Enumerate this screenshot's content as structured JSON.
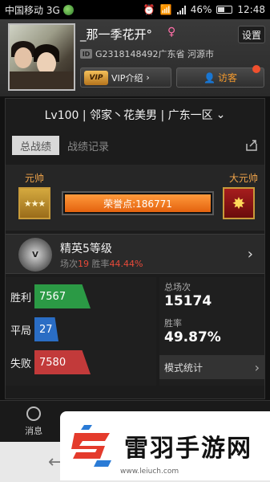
{
  "status_bar": {
    "carrier": "中国移动 3G",
    "network": "3G",
    "battery": "46%",
    "time": "12:48"
  },
  "profile": {
    "nickname": "_那一季花开°",
    "gender_symbol": "♀",
    "id_badge": "ID",
    "id_location": "G2318148492广东省 河源市",
    "settings_label": "设置",
    "vip_logo": "VIP",
    "vip_label": "VIP介绍",
    "visitor_label": "访客"
  },
  "card": {
    "level_title": "Lv100 | 邻家丶花美男 | 广东一区",
    "tabs": [
      {
        "label": "总战绩",
        "active": true
      },
      {
        "label": "战绩记录",
        "active": false
      }
    ],
    "rank": {
      "left_label": "元帅",
      "right_label": "大元帅",
      "left_stars": "★★★",
      "right_star": "✸",
      "honor_text": "荣誉点:186771",
      "honor_progress": 1.0
    },
    "elite": {
      "badge": "V",
      "title": "精英5等级",
      "sub_prefix": "场次",
      "matches": "19",
      "sub_mid": " 胜率",
      "win_rate": "44.44%"
    },
    "stats": {
      "win_label": "胜利",
      "win_value": "7567",
      "draw_label": "平局",
      "draw_value": "27",
      "lose_label": "失败",
      "lose_value": "7580",
      "total_label": "总场次",
      "total_value": "15174",
      "rate_label": "胜率",
      "rate_value": "49.87%",
      "mode_label": "模式统计"
    }
  },
  "bottom_nav": [
    {
      "label": "消息"
    },
    {
      "label": ""
    },
    {
      "label": ""
    },
    {
      "label": ""
    }
  ],
  "watermark": {
    "title": "雷羽手游网",
    "url": "www.leiuch.com"
  },
  "colors": {
    "accent_orange": "#e4620e",
    "win_green": "#2b9a45",
    "draw_blue": "#2a6dc4",
    "lose_red": "#c23a3a"
  }
}
